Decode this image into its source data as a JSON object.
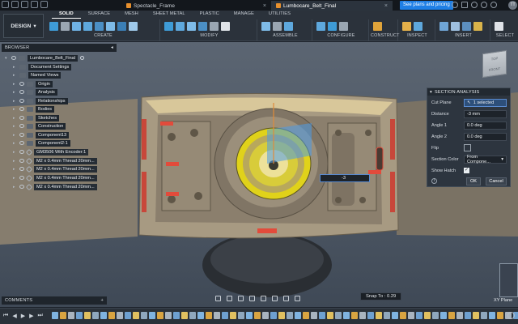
{
  "tabs": [
    {
      "label": "Spectacle_Frame"
    },
    {
      "label": "Lumbocare_Belt_Final"
    }
  ],
  "plans_button": "See plans and pricing",
  "avatar_initials": "TT",
  "toolbar": {
    "design_label": "DESIGN",
    "workspace_tabs": [
      "SOLID",
      "SURFACE",
      "MESH",
      "SHEET METAL",
      "PLASTIC",
      "MANAGE",
      "UTILITIES"
    ],
    "groups": [
      "CREATE",
      "MODIFY",
      "ASSEMBLE",
      "CONFIGURE",
      "CONSTRUCT",
      "INSPECT",
      "INSERT",
      "SELECT"
    ]
  },
  "browser": {
    "title": "BROWSER",
    "root_label": "Lumbocare_Belt_Final",
    "items": [
      "Document Settings",
      "Named Views",
      "Origin",
      "Analysis",
      "Relationships",
      "Bodies",
      "Sketches",
      "Construction",
      "Component13",
      "Component2:1",
      "GM3506 With Encoder:1",
      "M2 x 0.4mm Thread 20mm...",
      "M2 x 0.4mm Thread 20mm...",
      "M2 x 0.4mm Thread 20mm...",
      "M2 x 0.4mm Thread 20mm..."
    ]
  },
  "section_analysis": {
    "title": "SECTION ANALYSIS",
    "cut_plane_label": "Cut Plane",
    "cut_plane_value": "1 selected",
    "distance_label": "Distance",
    "distance_value": "-3 mm",
    "angle1_label": "Angle 1",
    "angle1_value": "0.0 deg",
    "angle2_label": "Angle 2",
    "angle2_value": "0.0 deg",
    "flip_label": "Flip",
    "section_color_label": "Section Color",
    "section_color_value": "From Compone...",
    "show_hatch_label": "Show Hatch",
    "ok_label": "OK",
    "cancel_label": "Cancel"
  },
  "distance_input": "-3",
  "comments_label": "COMMENTS",
  "snap_label": "Snap To : 0.29",
  "xy_plane_label": "XY Plane",
  "viewcube": {
    "top": "TOP",
    "front": "FRONT"
  },
  "colors": {
    "accent": "#1f7fe5",
    "model_tan": "#9a8e7a",
    "bearing_yellow": "#e0d21a"
  }
}
